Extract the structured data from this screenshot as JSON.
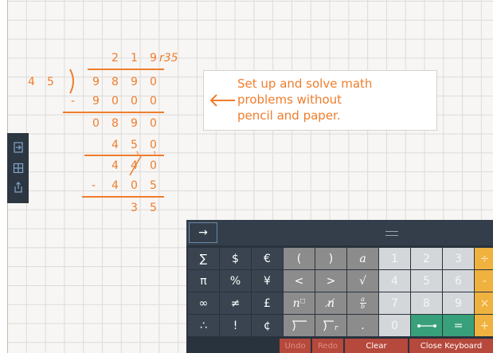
{
  "division": {
    "quotient": [
      "2",
      "1",
      "9"
    ],
    "remainder_label": "r35",
    "divisor": [
      "4",
      "5"
    ],
    "dividend": [
      "9",
      "8",
      "9",
      "0"
    ],
    "step1": {
      "sign": "-",
      "digits": [
        "9",
        "0",
        "0",
        "0"
      ]
    },
    "diff1": [
      "0",
      "8",
      "9",
      "0"
    ],
    "step2_top": [
      "4",
      "5",
      "0"
    ],
    "step2_mid": [
      "4",
      "4",
      "0"
    ],
    "carry_3": "3",
    "carry_1": "1",
    "step3": {
      "sign": "-",
      "digits": [
        "4",
        "0",
        "5"
      ]
    },
    "final": [
      "3",
      "5"
    ]
  },
  "callout": {
    "text": "Set up and solve math\nproblems without\npencil and paper."
  },
  "toolbar": {
    "icons": [
      "import-icon",
      "grid-icon",
      "share-icon"
    ]
  },
  "keyboard": {
    "toggle_label": "→",
    "rows": [
      [
        "∑",
        "$",
        "€",
        "(",
        ")",
        "a",
        "1",
        "2",
        "3",
        "÷"
      ],
      [
        "π",
        "%",
        "¥",
        "<",
        ">",
        "√",
        "4",
        "5",
        "6",
        "-"
      ],
      [
        "∞",
        "≠",
        "£",
        "nᐧ",
        "n̸",
        "a/b",
        "7",
        "8",
        "9",
        "×"
      ],
      [
        "∴",
        "!",
        "¢",
        "long-division",
        "long-division-r",
        ".",
        "0",
        "⟷",
        "=",
        "+"
      ]
    ],
    "undo_label": "Undo",
    "redo_label": "Redo",
    "clear_label": "Clear",
    "close_label": "Close Keyboard"
  },
  "colors": {
    "accent": "#ef7d2d",
    "keyboard_bg": "#29333d",
    "operator": "#f0b23e",
    "action": "#b6483c",
    "green": "#38a07a"
  }
}
